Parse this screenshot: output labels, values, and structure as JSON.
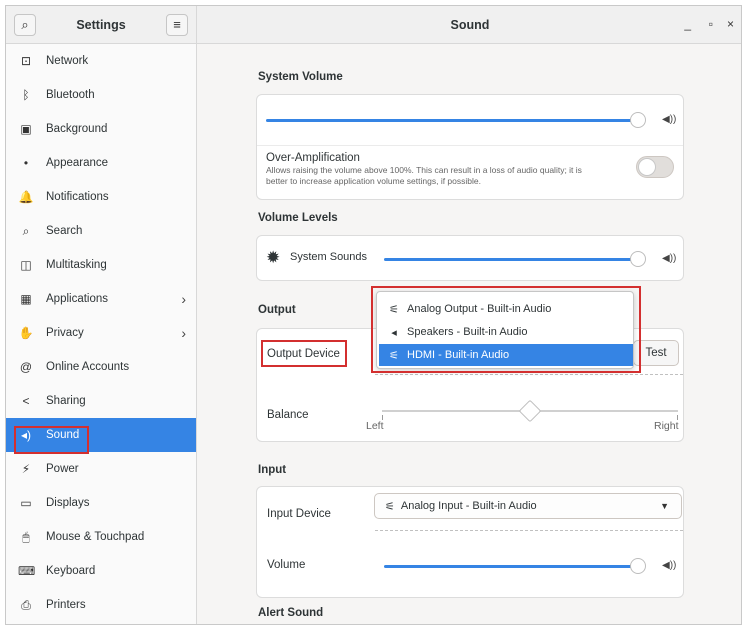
{
  "sidebar": {
    "title": "Settings",
    "search_icon": "⌕",
    "menu_icon": "≡",
    "items": [
      {
        "label": "Network",
        "icon": "⊡"
      },
      {
        "label": "Bluetooth",
        "icon": "ᛒ"
      },
      {
        "label": "Background",
        "icon": "▣"
      },
      {
        "label": "Appearance",
        "icon": "•"
      },
      {
        "label": "Notifications",
        "icon": "🔔"
      },
      {
        "label": "Search",
        "icon": "⌕"
      },
      {
        "label": "Multitasking",
        "icon": "◫"
      },
      {
        "label": "Applications",
        "icon": "▦",
        "chevron": "›"
      },
      {
        "label": "Privacy",
        "icon": "✋",
        "chevron": "›"
      },
      {
        "label": "Online Accounts",
        "icon": "@"
      },
      {
        "label": "Sharing",
        "icon": "<"
      },
      {
        "label": "Sound",
        "icon": "◂)"
      },
      {
        "label": "Power",
        "icon": "⚡"
      },
      {
        "label": "Displays",
        "icon": "▭"
      },
      {
        "label": "Mouse & Touchpad",
        "icon": "🖱"
      },
      {
        "label": "Keyboard",
        "icon": "⌨"
      },
      {
        "label": "Printers",
        "icon": "⎙"
      }
    ]
  },
  "header": {
    "title": "Sound",
    "minimize": "_",
    "maximize": "▫",
    "close": "×"
  },
  "system_volume": {
    "title": "System Volume",
    "over_amp_title": "Over-Amplification",
    "over_amp_desc_1": "Allows raising the volume above 100%. This can result in a loss of audio quality; it is",
    "over_amp_desc_2": "better to increase application volume settings, if possible.",
    "level": 1.0
  },
  "volume_levels": {
    "title": "Volume Levels",
    "system_sounds": "System Sounds",
    "level": 1.0
  },
  "output": {
    "title": "Output",
    "device_label": "Output Device",
    "test_label": "Test",
    "balance_label": "Balance",
    "left_label": "Left",
    "right_label": "Right",
    "balance": 0.5
  },
  "dropdown": {
    "items": [
      {
        "label": "Analog Output - Built-in Audio",
        "icon": "⚟"
      },
      {
        "label": "Speakers - Built-in Audio",
        "icon": "◂"
      },
      {
        "label": "HDMI - Built-in Audio",
        "icon": "⚟"
      }
    ]
  },
  "input": {
    "title": "Input",
    "device_label": "Input Device",
    "device_value": "Analog Input - Built-in Audio",
    "volume_label": "Volume",
    "level": 1.0
  },
  "alert": {
    "title": "Alert Sound"
  },
  "colors": {
    "accent": "#3584e4",
    "highlight_box": "#d32f2f"
  }
}
